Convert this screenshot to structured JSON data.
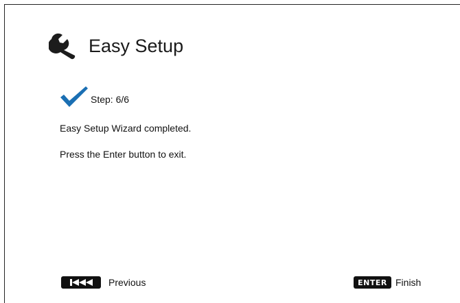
{
  "header": {
    "title": "Easy Setup",
    "icon": "wrench-icon"
  },
  "step": {
    "label": "Step: 6/6",
    "icon": "checkmark-icon",
    "icon_color": "#1a6fb3"
  },
  "messages": {
    "completed": "Easy Setup Wizard completed.",
    "instruction": "Press the Enter button to exit."
  },
  "footer": {
    "previous": {
      "key_icon": "skip-back-icon",
      "label": "Previous"
    },
    "finish": {
      "key_label": "ENTER",
      "label": "Finish"
    }
  }
}
